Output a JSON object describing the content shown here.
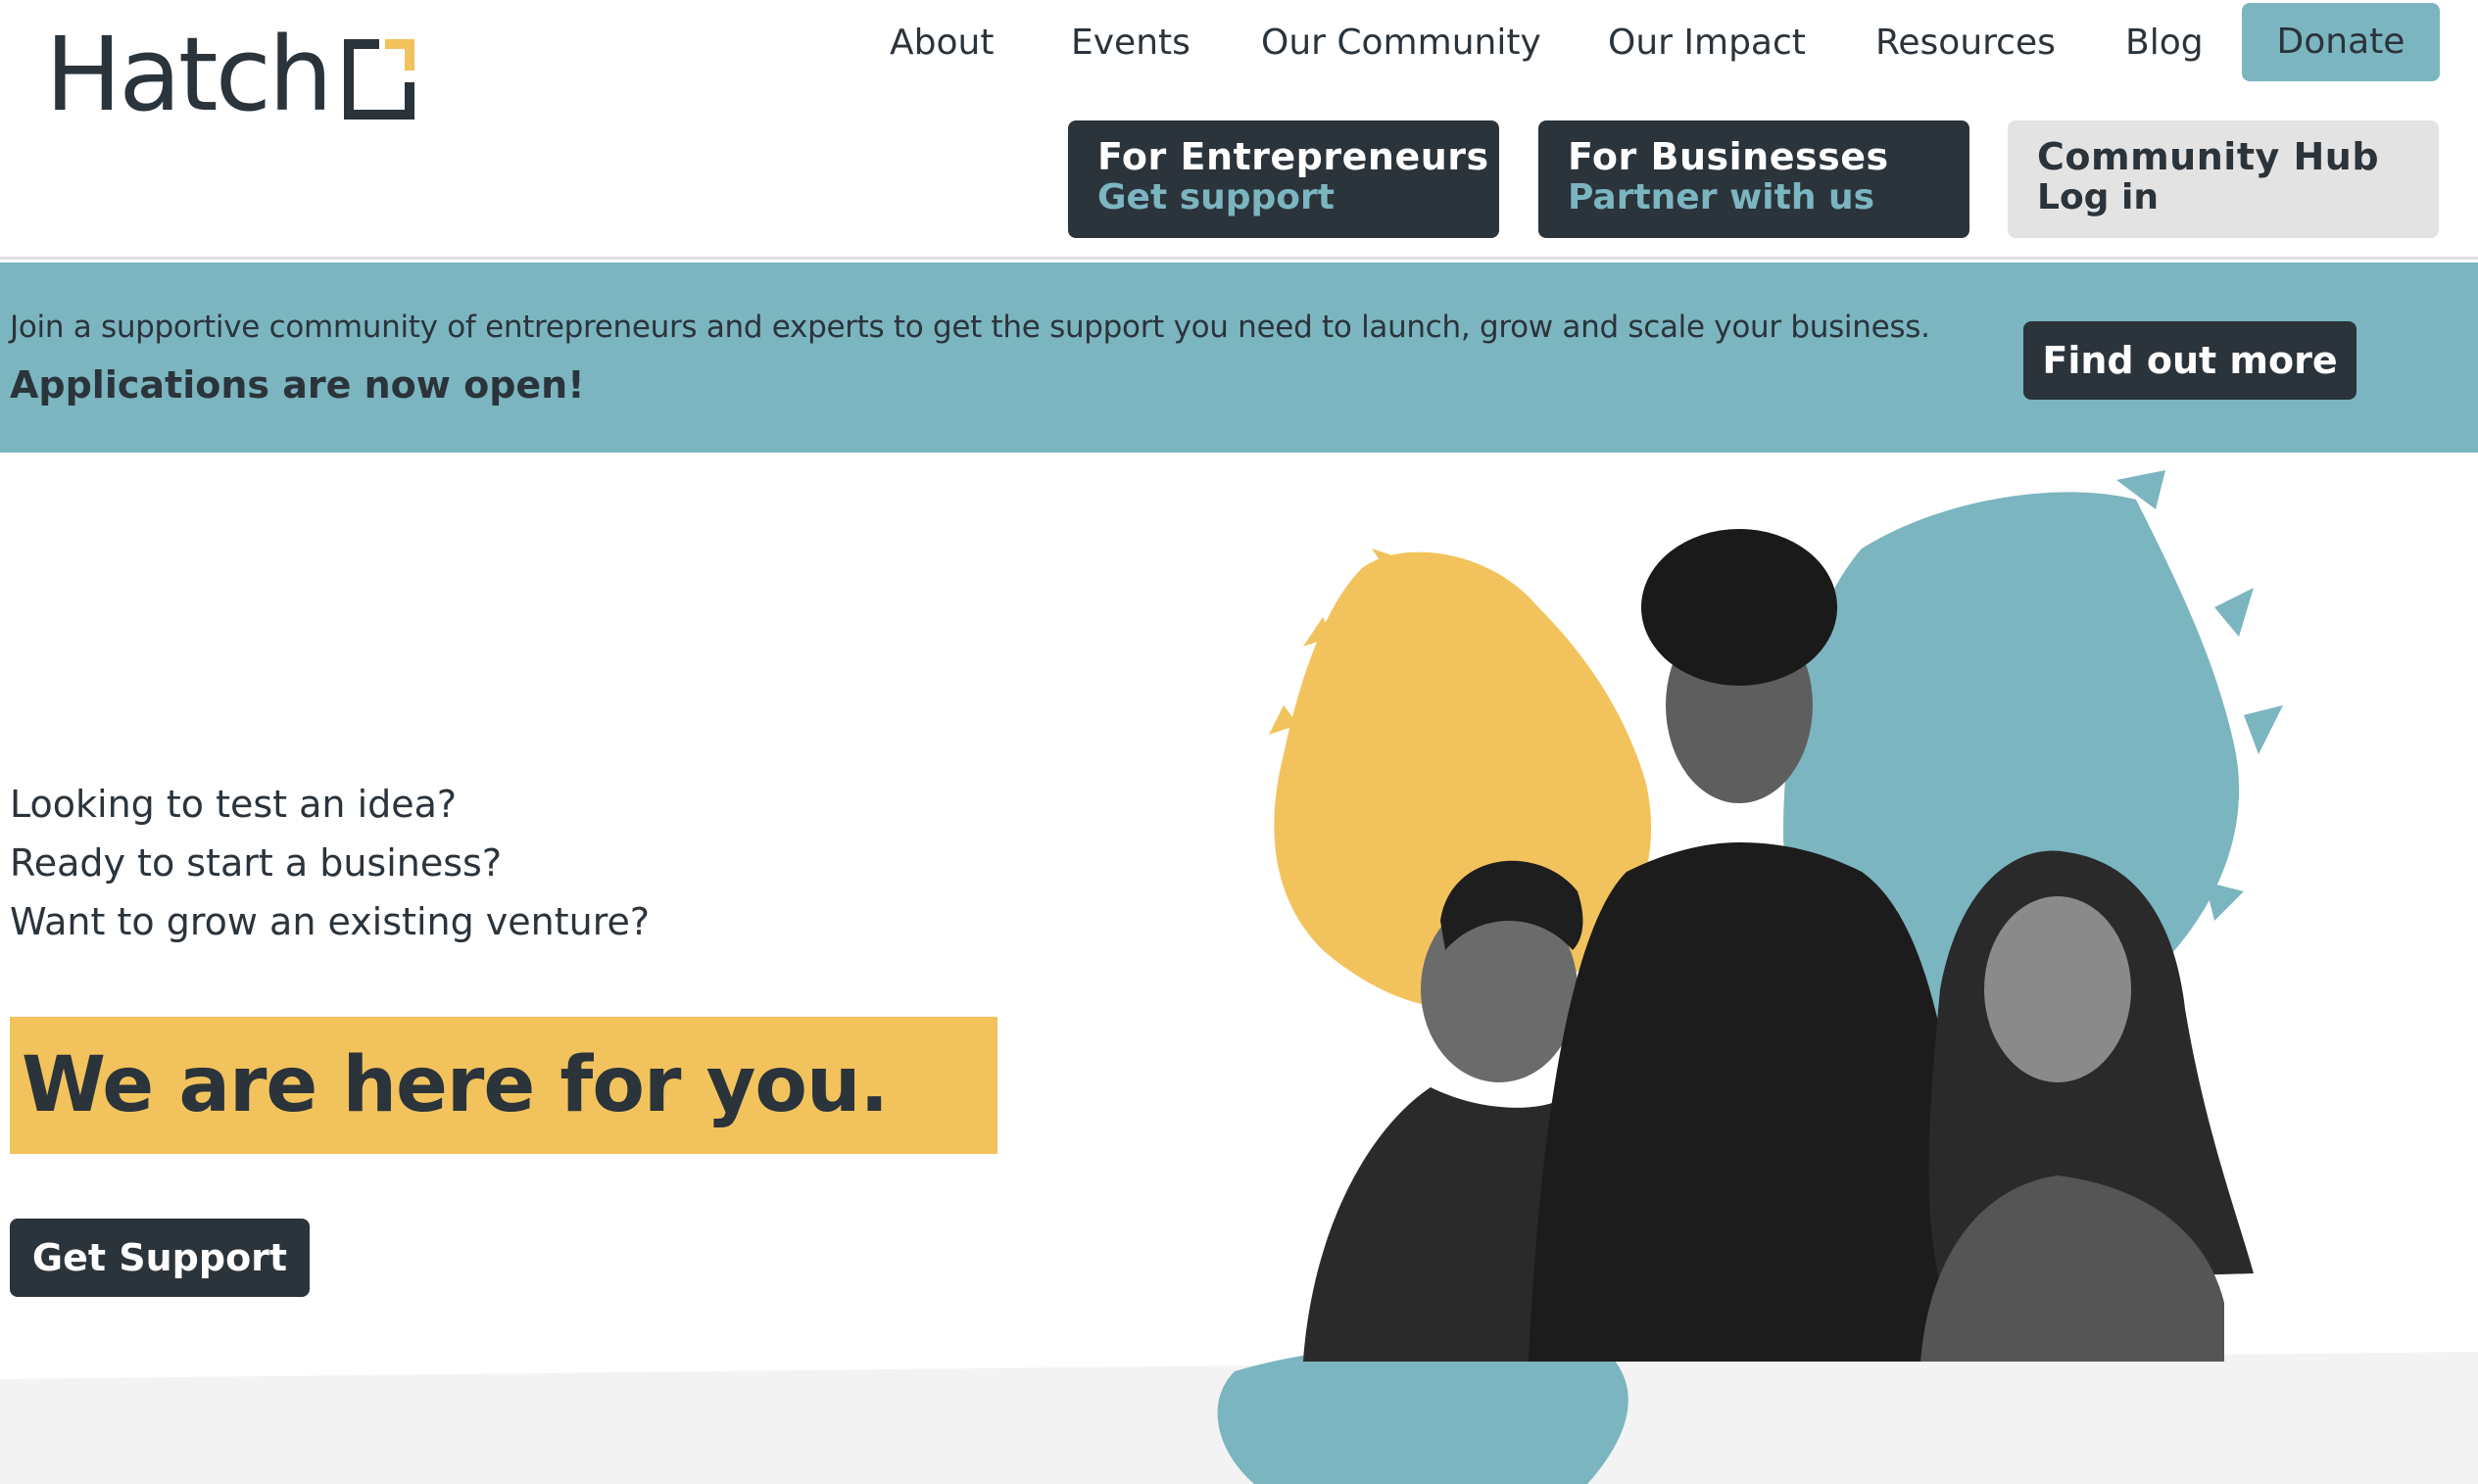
{
  "brand": {
    "name": "Hatch"
  },
  "nav": {
    "items": [
      "About",
      "Events",
      "Our Community",
      "Our Impact",
      "Resources",
      "Blog"
    ],
    "donate": "Donate"
  },
  "portals": [
    {
      "title": "For Entrepreneurs",
      "subtitle": "Get support"
    },
    {
      "title": "For Businesses",
      "subtitle": "Partner with us"
    },
    {
      "title": "Community Hub",
      "subtitle": "Log in"
    }
  ],
  "banner": {
    "text": "Join a supportive community of entrepreneurs and experts to get the support you need to launch, grow and scale your business.",
    "highlight": "Applications are now open!",
    "button": "Find out more"
  },
  "hero": {
    "questions": [
      "Looking to test an idea?",
      "Ready to start a business?",
      "Want to grow an existing venture?"
    ],
    "tagline": "We are here for you.",
    "button": "Get Support"
  },
  "colors": {
    "teal": "#7bb5c0",
    "yellow": "#f2c35c",
    "dark": "#2b333b"
  }
}
